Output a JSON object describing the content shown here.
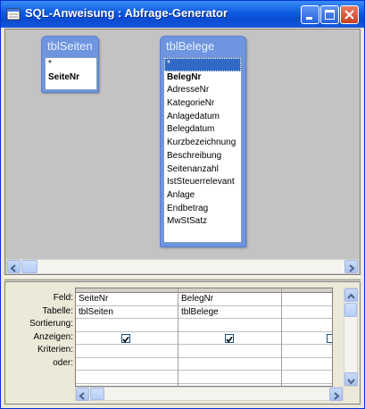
{
  "window": {
    "title": "SQL-Anweisung : Abfrage-Generator"
  },
  "design": {
    "tables": [
      {
        "name": "tblSeiten",
        "fields": [
          "*",
          "SeiteNr"
        ]
      },
      {
        "name": "tblBelege",
        "fields": [
          "*",
          "BelegNr",
          "AdresseNr",
          "KategorieNr",
          "Anlagedatum",
          "Belegdatum",
          "Kurzbezeichnung",
          "Beschreibung",
          "Seitenanzahl",
          "IstSteuerrelevant",
          "Anlage",
          "Endbetrag",
          "MwStSatz"
        ]
      }
    ]
  },
  "grid": {
    "row_labels": [
      "Feld:",
      "Tabelle:",
      "Sortierung:",
      "Anzeigen:",
      "Kriterien:",
      "oder:"
    ],
    "columns": [
      {
        "feld": "SeiteNr",
        "tabelle": "tblSeiten",
        "sortierung": "",
        "anzeigen": true
      },
      {
        "feld": "BelegNr",
        "tabelle": "tblBelege",
        "sortierung": "",
        "anzeigen": true
      },
      {
        "feld": "",
        "tabelle": "",
        "sortierung": "",
        "anzeigen": false
      }
    ]
  },
  "colors": {
    "title_bar": "#0d5ae3",
    "table_header": "#6f95e0",
    "selection": "#316ac5"
  }
}
